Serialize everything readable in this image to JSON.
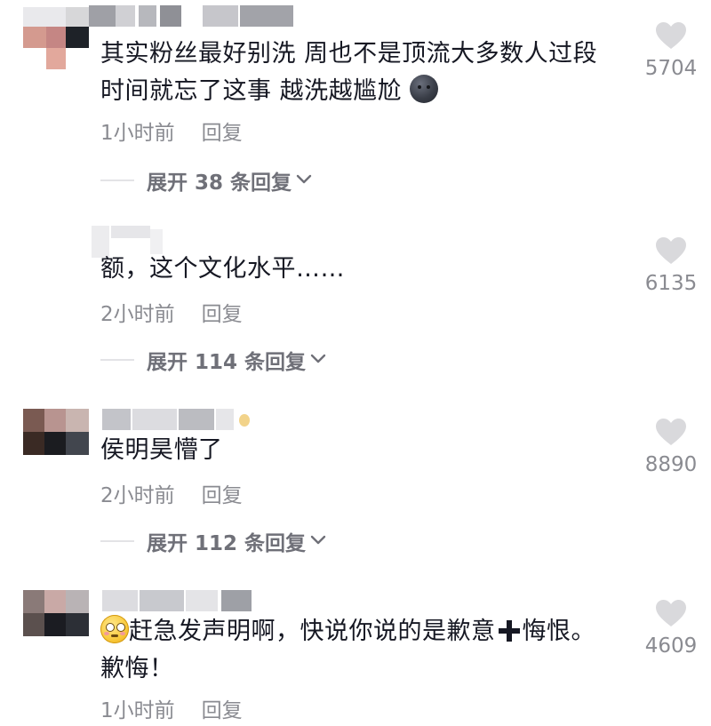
{
  "comments": [
    {
      "text_line1": "其实粉丝最好别洗 周也不是顶流大多数人过段",
      "text_line2": "时间就忘了这事 越洗越尴尬",
      "emoji": "new-moon-face",
      "time": "1小时前",
      "reply": "回复",
      "likes": "5704",
      "expand": "展开 38 条回复"
    },
    {
      "text": "额，这个文化水平……",
      "time": "2小时前",
      "reply": "回复",
      "likes": "6135",
      "expand": "展开 114 条回复"
    },
    {
      "text": "侯明昊懵了",
      "time": "2小时前",
      "reply": "回复",
      "likes": "8890",
      "expand": "展开 112 条回复"
    },
    {
      "emoji": "flushed-face",
      "text_line1": "赶急发声明啊，快说你说的是歉意",
      "text_line1_end": "悔恨。",
      "text_line2": "歉悔！",
      "time": "1小时前",
      "reply": "回复",
      "likes": "4609"
    }
  ],
  "colors": {
    "text": "#161823",
    "meta": "#8a8b91",
    "expand": "#6f7078",
    "heart": "#d9d9dc"
  }
}
